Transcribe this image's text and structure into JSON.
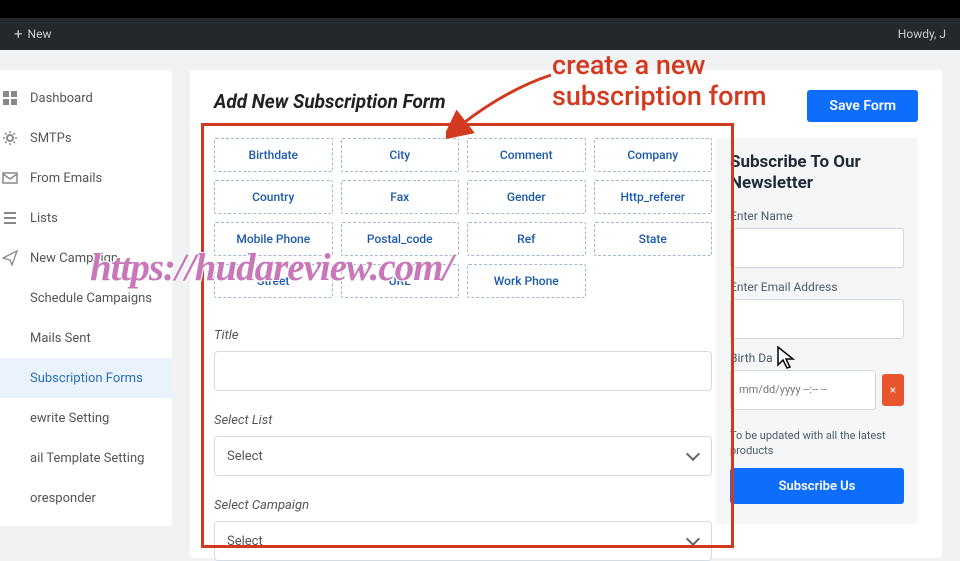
{
  "adminbar": {
    "new": "New",
    "howdy": "Howdy, J"
  },
  "sidebar": {
    "items": [
      {
        "label": "Dashboard"
      },
      {
        "label": "SMTPs"
      },
      {
        "label": "From Emails"
      },
      {
        "label": "Lists"
      },
      {
        "label": "New Campaign"
      },
      {
        "label": "Schedule Campaigns"
      },
      {
        "label": "Mails Sent"
      },
      {
        "label": "Subscription Forms"
      },
      {
        "label": "ewrite Setting"
      },
      {
        "label": "ail Template Setting"
      },
      {
        "label": "oresponder"
      }
    ]
  },
  "main": {
    "title": "Add New Subscription Form",
    "save": "Save Form",
    "fields": [
      "Birthdate",
      "City",
      "Comment",
      "Company",
      "Country",
      "Fax",
      "Gender",
      "Http_referer",
      "Mobile Phone",
      "Postal_code",
      "Ref",
      "State",
      "Street",
      "URL",
      "Work Phone"
    ],
    "label_title": "Title",
    "label_list": "Select List",
    "label_campaign": "Select Campaign",
    "select_placeholder": "Select"
  },
  "preview": {
    "heading": "Subscribe To Our Newsletter",
    "name_label": "Enter Name",
    "email_label": "Enter Email Address",
    "birth_label": "Birth Da",
    "date_placeholder": "mm/dd/yyyy --:-- --",
    "delete_icon": "×",
    "note": "To be updated with all the latest products",
    "button": "Subscribe Us"
  },
  "annotation": {
    "line1": "create a new",
    "line2": "subscription form"
  },
  "watermark": "https://hudareview.com/"
}
